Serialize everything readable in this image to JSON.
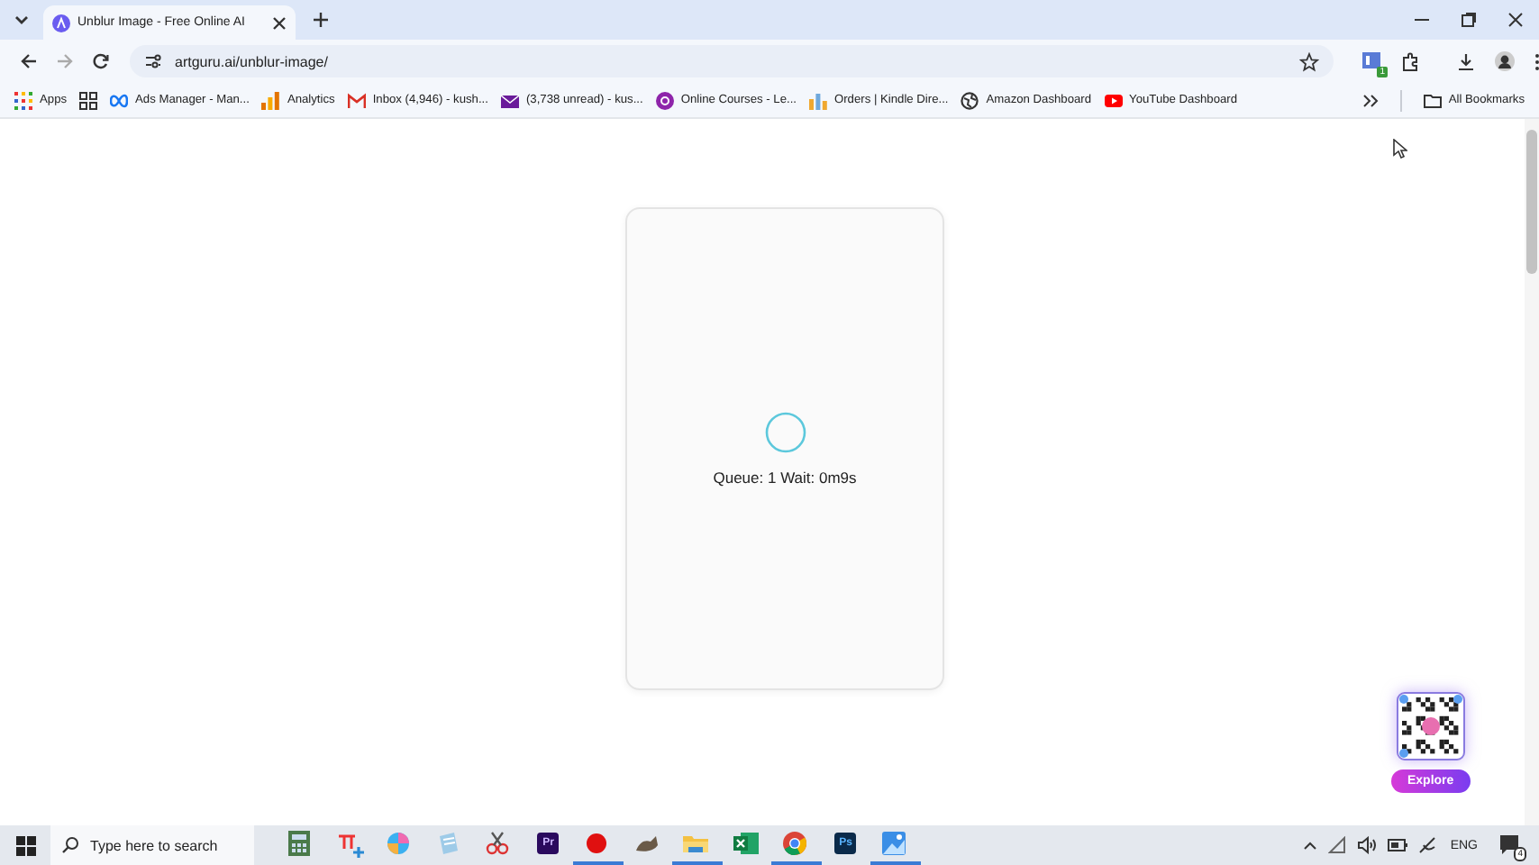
{
  "browser": {
    "tabs": [
      {
        "title": "Unblur Image - Free Online AI",
        "selected": true
      }
    ],
    "url": "artguru.ai/unblur-image/",
    "extension_badge": "1",
    "bookmarks": [
      {
        "label": "Apps"
      },
      {
        "label": "Ads Manager - Man..."
      },
      {
        "label": "Analytics"
      },
      {
        "label": "Inbox (4,946) - kush..."
      },
      {
        "label": "(3,738 unread) - kus..."
      },
      {
        "label": "Online Courses - Le..."
      },
      {
        "label": "Orders | Kindle Dire..."
      },
      {
        "label": "Amazon Dashboard"
      },
      {
        "label": "YouTube Dashboard"
      }
    ],
    "all_bookmarks": "All Bookmarks"
  },
  "page": {
    "status": "Queue: 1 Wait: 0m9s",
    "explore_label": "Explore"
  },
  "taskbar": {
    "search_placeholder": "Type here to search",
    "apps": [
      {
        "active": false
      },
      {
        "active": false
      },
      {
        "active": false
      },
      {
        "active": false
      },
      {
        "active": false
      },
      {
        "label": "Pr",
        "active": false
      },
      {
        "active": true
      },
      {
        "active": false
      },
      {
        "active": true
      },
      {
        "active": false
      },
      {
        "active": true
      },
      {
        "label": "Ps",
        "active": false
      },
      {
        "active": true
      }
    ],
    "language": "ENG",
    "notification_count": "4"
  }
}
